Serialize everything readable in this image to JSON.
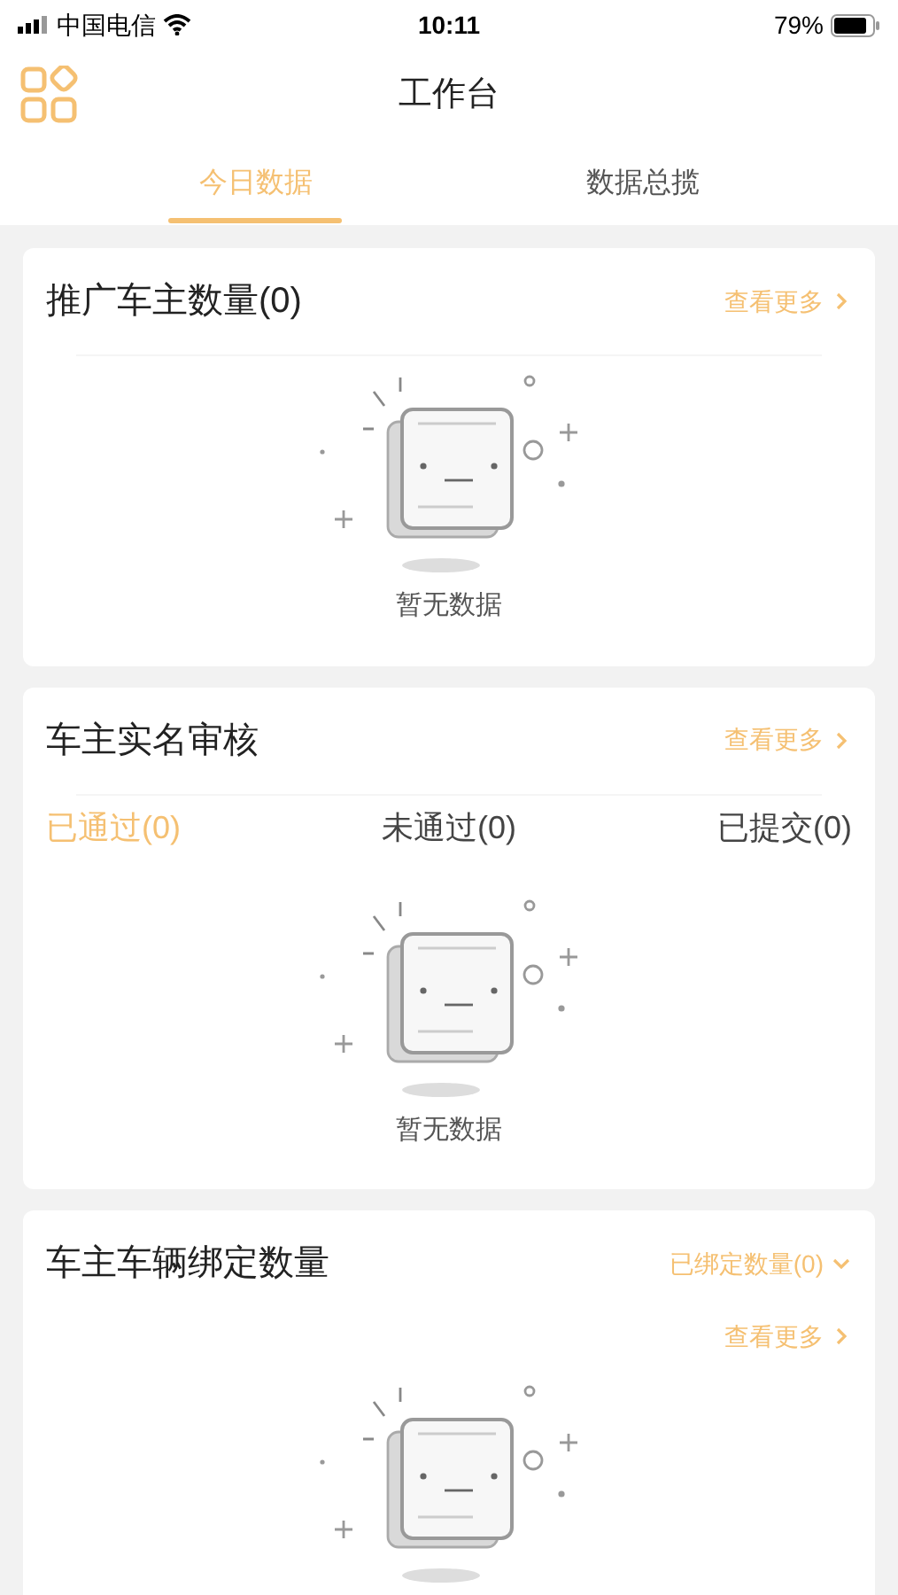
{
  "status_bar": {
    "carrier": "中国电信",
    "time": "10:11",
    "battery": "79%"
  },
  "header": {
    "title": "工作台"
  },
  "tabs": [
    {
      "label": "今日数据",
      "selected": true
    },
    {
      "label": "数据总揽",
      "selected": false
    }
  ],
  "cards": [
    {
      "title": "推广车主数量(0)",
      "more": "查看更多",
      "empty_text": "暂无数据"
    },
    {
      "title": "车主实名审核",
      "more": "查看更多",
      "filters": [
        {
          "label": "已通过(0)",
          "selected": true
        },
        {
          "label": "未通过(0)",
          "selected": false
        },
        {
          "label": "已提交(0)",
          "selected": false
        }
      ],
      "empty_text": "暂无数据"
    },
    {
      "title": "车主车辆绑定数量",
      "dropdown": "已绑定数量(0)",
      "more": "查看更多"
    }
  ]
}
